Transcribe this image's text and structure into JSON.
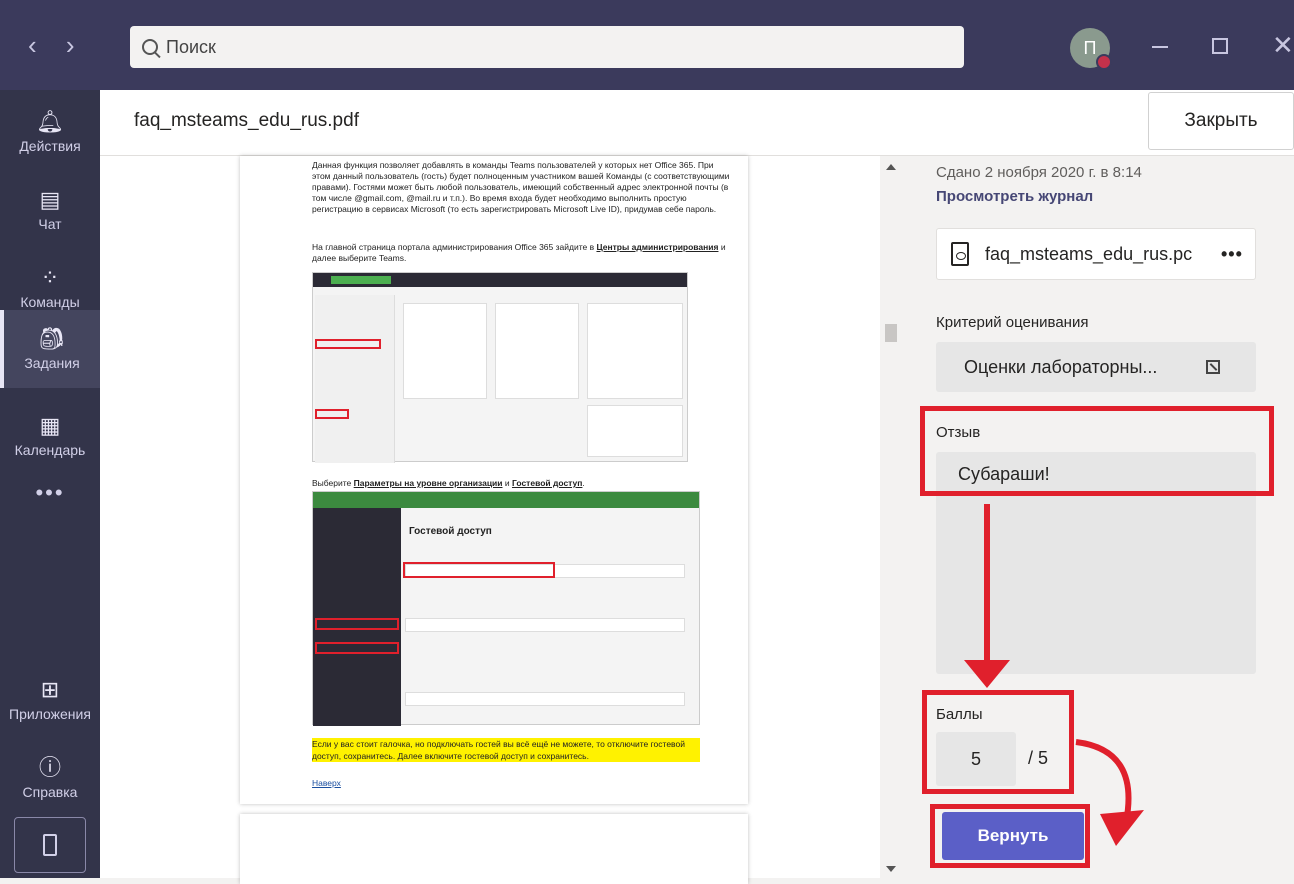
{
  "window": {
    "back": "‹",
    "forward": "›",
    "search_placeholder": "Поиск",
    "avatar_initial": "П"
  },
  "sidebar": {
    "items": [
      {
        "label": "Действия",
        "icon": "bell-icon"
      },
      {
        "label": "Чат",
        "icon": "chat-icon"
      },
      {
        "label": "Команды",
        "icon": "teams-icon"
      },
      {
        "label": "Задания",
        "icon": "assignments-icon"
      },
      {
        "label": "Календарь",
        "icon": "calendar-icon"
      },
      {
        "label": "Приложения",
        "icon": "apps-icon"
      },
      {
        "label": "Справка",
        "icon": "help-icon"
      }
    ],
    "more": "•••",
    "active": "Задания"
  },
  "header": {
    "title": "faq_msteams_edu_rus.pdf",
    "close_label": "Закрыть"
  },
  "document": {
    "para1": "Данная функция позволяет добавлять в команды Teams пользователей у которых нет Office 365. При этом данный пользователь (гость) будет полноценным участником вашей Команды (с соответствующими правами). Гостями может быть любой пользователь, имеющий собственный адрес электронной почты (в том числе @gmail.com, @mail.ru и т.п.). Во время входа будет необходимо выполнить простую регистрацию в сервисах Microsoft (то есть зарегистрировать Microsoft Live ID), придумав себе пароль.",
    "para2_a": "На главной страница портала администрирования Office 365 зайдите в ",
    "para2_link": "Центры администрирования",
    "para2_b": " и далее выберите Teams.",
    "para3_a": "Выберите ",
    "para3_link1": "Параметры на уровне организации",
    "para3_mid": " и ",
    "para3_link2": "Гостевой доступ",
    "para3_end": ".",
    "shot2_title": "Гостевой доступ",
    "highlight": "Если у вас стоит галочка, но подключать гостей вы всё ещё не можете, то отключите гостевой доступ, сохранитесь. Далее включите гостевой доступ и сохранитесь.",
    "back_link": "Наверх"
  },
  "panel": {
    "submitted": "Сдано 2 ноября 2020 г. в 8:14",
    "view_log": "Просмотреть журнал",
    "file_name": "faq_msteams_edu_rus.pc",
    "file_more": "•••",
    "criteria_label": "Критерий оценивания",
    "rubric_name": "Оценки лабораторны...",
    "feedback_label": "Отзыв",
    "feedback_text": "Субараши!",
    "points_label": "Баллы",
    "points_value": "5",
    "points_max": "/ 5",
    "return_label": "Вернуть"
  },
  "colors": {
    "titlebar": "#3b3a5c",
    "sidebar": "#33344a",
    "accent": "#5b5fc7",
    "annotation": "#e0202c"
  }
}
